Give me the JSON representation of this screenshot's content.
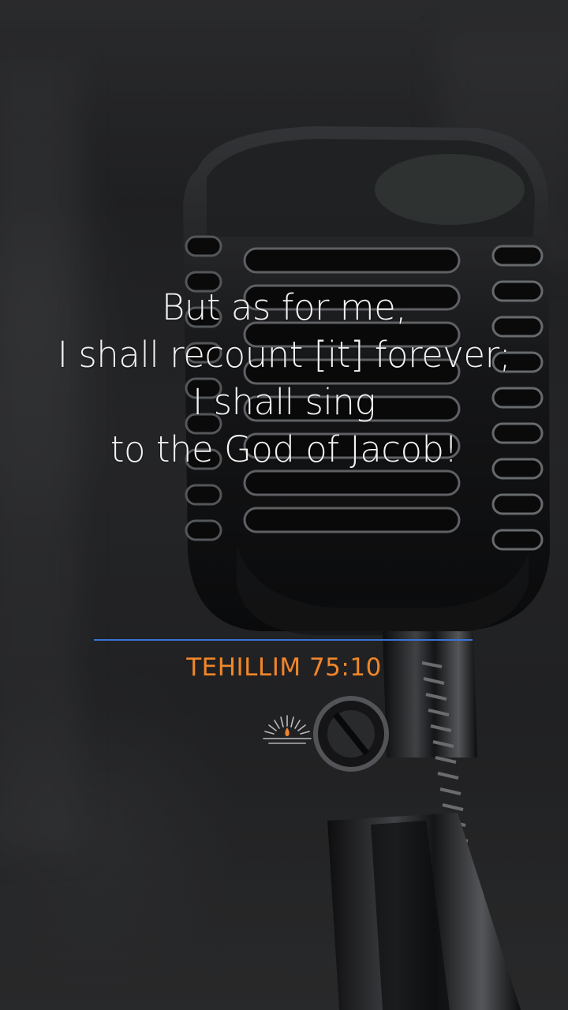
{
  "verse": {
    "lines": [
      "But as for me,",
      "I shall recount [it] forever;",
      "I shall sing",
      "to the God of Jacob!"
    ]
  },
  "reference": "TEHILLIM 75:10",
  "colors": {
    "verse_text": "#f2f2f2",
    "reference_text": "#f0862a",
    "divider": "#3a73d8"
  },
  "icons": {
    "logo": "sunrise-candle-logo-icon"
  },
  "background": {
    "subject": "vintage-chrome-microphone"
  }
}
